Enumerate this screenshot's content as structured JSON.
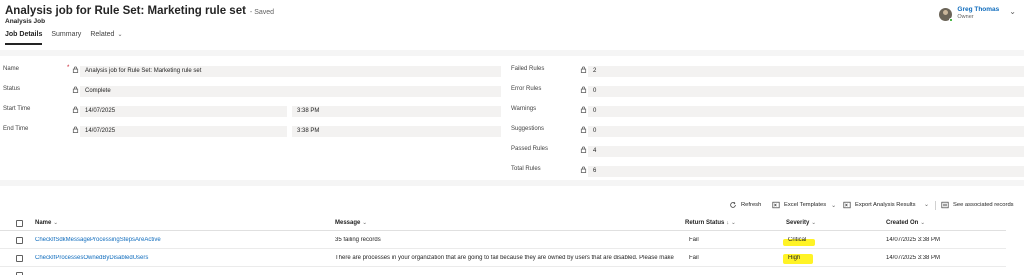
{
  "header": {
    "title": "Analysis job for Rule Set: Marketing rule set",
    "saved_status": "- Saved",
    "entity_type": "Analysis Job",
    "owner_name": "Greg Thomas",
    "owner_role": "Owner"
  },
  "tabs": [
    {
      "label": "Job Details",
      "active": true
    },
    {
      "label": "Summary",
      "active": false
    },
    {
      "label": "Related",
      "active": false
    }
  ],
  "form": {
    "name": {
      "label": "Name",
      "value": "Analysis job for Rule Set: Marketing rule set"
    },
    "status": {
      "label": "Status",
      "value": "Complete"
    },
    "start_time": {
      "label": "Start Time",
      "date": "14/07/2025",
      "time": "3:38 PM"
    },
    "end_time": {
      "label": "End Time",
      "date": "14/07/2025",
      "time": "3:38 PM"
    },
    "failed_rules": {
      "label": "Failed Rules",
      "value": "2"
    },
    "error_rules": {
      "label": "Error Rules",
      "value": "0"
    },
    "warnings": {
      "label": "Warnings",
      "value": "0"
    },
    "suggestions": {
      "label": "Suggestions",
      "value": "0"
    },
    "passed_rules": {
      "label": "Passed Rules",
      "value": "4"
    },
    "total_rules": {
      "label": "Total Rules",
      "value": "6"
    }
  },
  "commands": {
    "refresh": "Refresh",
    "excel_templates": "Excel Templates",
    "export": "Export Analysis Results",
    "see_associated": "See associated records"
  },
  "grid": {
    "columns": {
      "name": "Name",
      "message": "Message",
      "return_status": "Return Status",
      "severity": "Severity",
      "created_on": "Created On"
    },
    "rows": [
      {
        "name": "CheckIfSdkMessageProcessingStepsAreActive",
        "message": "35 failing records",
        "return_status": "Fail",
        "severity": "Critical",
        "created_on": "14/07/2025 3:38 PM"
      },
      {
        "name": "CheckIfProcessesOwnedByDisabledUsers",
        "message": "There are processes in your organization that are going to fail because they are owned by users that are disabled. Please make sure",
        "return_status": "Fail",
        "severity": "High",
        "created_on": "14/07/2025 3:38 PM"
      }
    ]
  },
  "colors": {
    "accent": "#0f6cbd",
    "highlight": "#fff100",
    "background": "#f5f5f5",
    "required": "#c50f1f"
  }
}
